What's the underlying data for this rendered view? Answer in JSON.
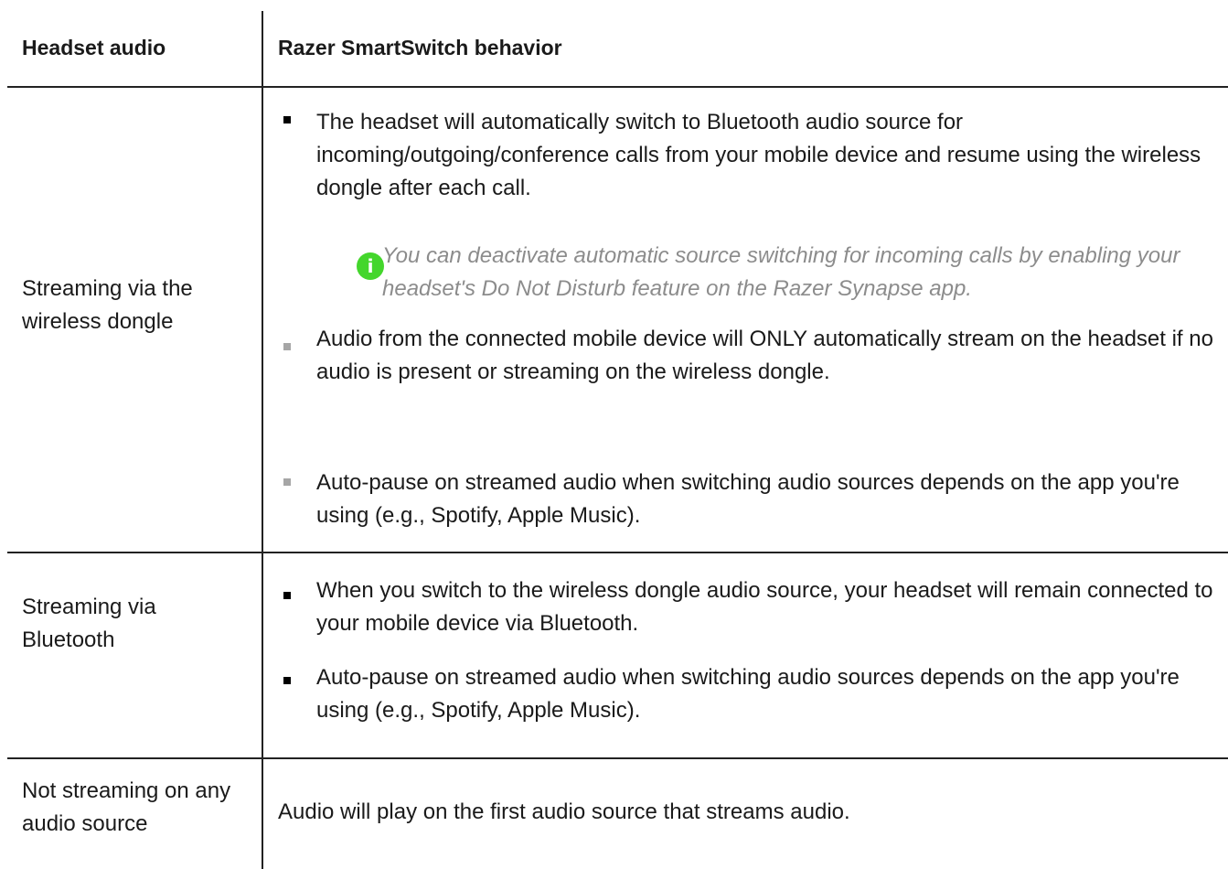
{
  "table": {
    "header": {
      "col1": "Headset audio",
      "col2": "Razer SmartSwitch behavior"
    },
    "rows": [
      {
        "mode": "Streaming via the wireless dongle",
        "bullets": [
          "The headset will automatically switch to Bluetooth audio source for incoming/outgoing/conference calls from your mobile device and resume using the wireless dongle after each call.",
          "Audio from the connected mobile device will ONLY automatically stream on the headset if no audio is present or streaming on the wireless dongle.",
          "Auto-pause on streamed audio when switching audio sources depends on the app you're using (e.g., Spotify, Apple Music)."
        ],
        "note": {
          "icon": "info-icon",
          "text": "You can deactivate automatic source switching for incoming calls by enabling your headset's Do Not Disturb feature on the Razer Synapse app."
        }
      },
      {
        "mode": "Streaming via Bluetooth",
        "bullets": [
          "When you switch to the wireless dongle audio source, your headset will remain connected to your mobile device via Bluetooth.",
          "Auto-pause on streamed audio when switching audio sources depends on the app you're using (e.g., Spotify, Apple Music)."
        ]
      },
      {
        "mode": "Not streaming on any audio source",
        "text": "Audio will play on the first audio source that streams audio."
      }
    ]
  },
  "colors": {
    "note_icon": "#44d62c",
    "note_text": "#8c8c8c",
    "bullet_dark": "#000000",
    "bullet_light": "#a6a6a6",
    "rule": "#222222"
  }
}
